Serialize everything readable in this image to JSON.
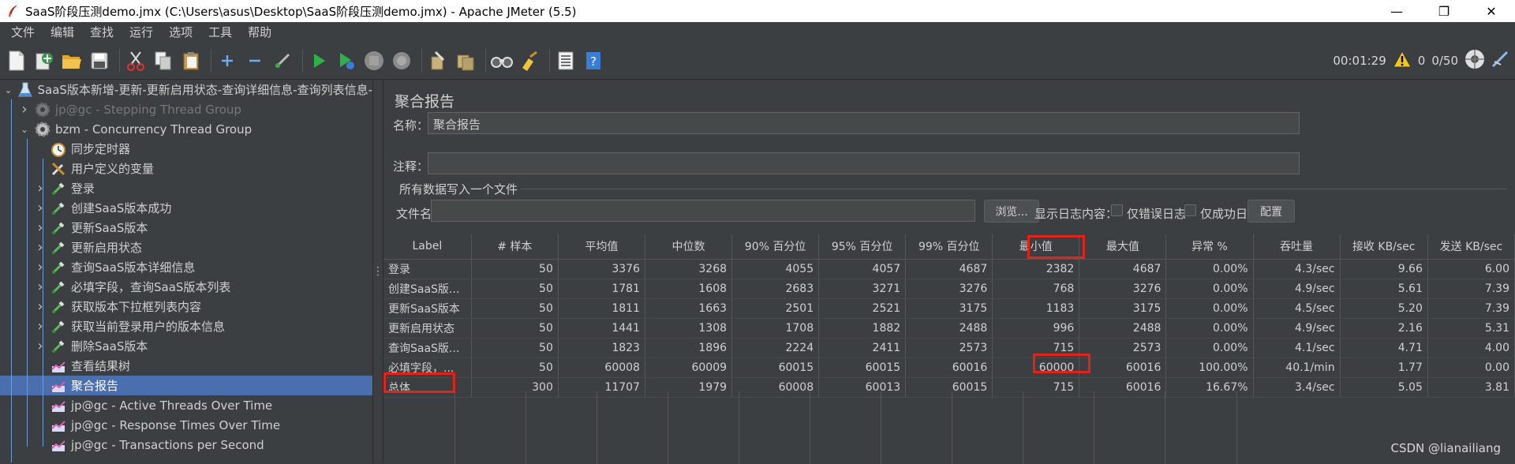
{
  "window": {
    "title": "SaaS阶段压测demo.jmx (C:\\Users\\asus\\Desktop\\SaaS阶段压测demo.jmx) - Apache JMeter (5.5)",
    "minimize": "—",
    "maximize": "❐",
    "close": "✕"
  },
  "menu": [
    "文件",
    "编辑",
    "查找",
    "运行",
    "选项",
    "工具",
    "帮助"
  ],
  "toolbar": {
    "elapsed": "00:01:29",
    "warnings": "0",
    "threads": "0/50"
  },
  "tree": [
    {
      "label": "SaaS版本新增-更新-更新启用状态-查询详细信息-查询列表信息-",
      "icon": "flask-icon",
      "arrow": "v",
      "indent": 0
    },
    {
      "label": "jp@gc - Stepping Thread Group",
      "icon": "gear-icon",
      "arrow": ">",
      "indent": 1,
      "disabled": true
    },
    {
      "label": "bzm - Concurrency Thread Group",
      "icon": "gear-icon",
      "arrow": "v",
      "indent": 1
    },
    {
      "label": "同步定时器",
      "icon": "timer-icon",
      "arrow": "",
      "indent": 2
    },
    {
      "label": "用户定义的变量",
      "icon": "tools-icon",
      "arrow": "",
      "indent": 2
    },
    {
      "label": "登录",
      "icon": "pipette-icon",
      "arrow": ">",
      "indent": 2
    },
    {
      "label": "创建SaaS版本成功",
      "icon": "pipette-icon",
      "arrow": ">",
      "indent": 2
    },
    {
      "label": "更新SaaS版本",
      "icon": "pipette-icon",
      "arrow": ">",
      "indent": 2
    },
    {
      "label": "更新启用状态",
      "icon": "pipette-icon",
      "arrow": ">",
      "indent": 2
    },
    {
      "label": "查询SaaS版本详细信息",
      "icon": "pipette-icon",
      "arrow": ">",
      "indent": 2
    },
    {
      "label": "必填字段，查询SaaS版本列表",
      "icon": "pipette-icon",
      "arrow": ">",
      "indent": 2
    },
    {
      "label": "获取版本下拉框列表内容",
      "icon": "pipette-icon",
      "arrow": ">",
      "indent": 2
    },
    {
      "label": "获取当前登录用户的版本信息",
      "icon": "pipette-icon",
      "arrow": ">",
      "indent": 2
    },
    {
      "label": "删除SaaS版本",
      "icon": "pipette-icon",
      "arrow": ">",
      "indent": 2
    },
    {
      "label": "查看结果树",
      "icon": "chart-icon",
      "arrow": "",
      "indent": 2
    },
    {
      "label": "聚合报告",
      "icon": "chart-icon",
      "arrow": "",
      "indent": 2,
      "selected": true
    },
    {
      "label": "jp@gc - Active Threads Over Time",
      "icon": "chart-icon",
      "arrow": "",
      "indent": 2
    },
    {
      "label": "jp@gc - Response Times Over Time",
      "icon": "chart-icon",
      "arrow": "",
      "indent": 2
    },
    {
      "label": "jp@gc - Transactions per Second",
      "icon": "chart-icon",
      "arrow": "",
      "indent": 2
    }
  ],
  "panel": {
    "title": "聚合报告",
    "name_label": "名称：",
    "name_value": "聚合报告",
    "comment_label": "注释：",
    "comment_value": "",
    "group_title": "所有数据写入一个文件",
    "file_label": "文件名",
    "file_value": "",
    "browse_button": "浏览...",
    "log_label": "显示日志内容：",
    "errors_only": "仅错误日志",
    "success_only": "仅成功日志",
    "configure_button": "配置"
  },
  "table": {
    "headers": [
      "Label",
      "# 样本",
      "平均值",
      "中位数",
      "90% 百分位",
      "95% 百分位",
      "99% 百分位",
      "最小值",
      "最大值",
      "异常 %",
      "吞吐量",
      "接收 KB/sec",
      "发送 KB/sec"
    ],
    "rows": [
      [
        "登录",
        "50",
        "3376",
        "3268",
        "4055",
        "4057",
        "4687",
        "2382",
        "4687",
        "0.00%",
        "4.3/sec",
        "9.66",
        "6.00"
      ],
      [
        "创建SaaS版...",
        "50",
        "1781",
        "1608",
        "2683",
        "3271",
        "3276",
        "768",
        "3276",
        "0.00%",
        "4.9/sec",
        "5.61",
        "7.39"
      ],
      [
        "更新SaaS版本",
        "50",
        "1811",
        "1663",
        "2501",
        "2521",
        "3175",
        "1183",
        "3175",
        "0.00%",
        "4.5/sec",
        "5.20",
        "7.39"
      ],
      [
        "更新启用状态",
        "50",
        "1441",
        "1308",
        "1708",
        "1882",
        "2488",
        "996",
        "2488",
        "0.00%",
        "4.9/sec",
        "2.16",
        "5.31"
      ],
      [
        "查询SaaS版...",
        "50",
        "1823",
        "1896",
        "2224",
        "2411",
        "2573",
        "715",
        "2573",
        "0.00%",
        "4.1/sec",
        "4.71",
        "4.00"
      ],
      [
        "必填字段，...",
        "50",
        "60008",
        "60009",
        "60015",
        "60015",
        "60016",
        "60000",
        "60016",
        "100.00%",
        "40.1/min",
        "1.77",
        "0.00"
      ],
      [
        "总体",
        "300",
        "11707",
        "1979",
        "60008",
        "60013",
        "60015",
        "715",
        "60016",
        "16.67%",
        "3.4/sec",
        "5.05",
        "3.81"
      ]
    ]
  },
  "watermark": "CSDN @lianailiang"
}
